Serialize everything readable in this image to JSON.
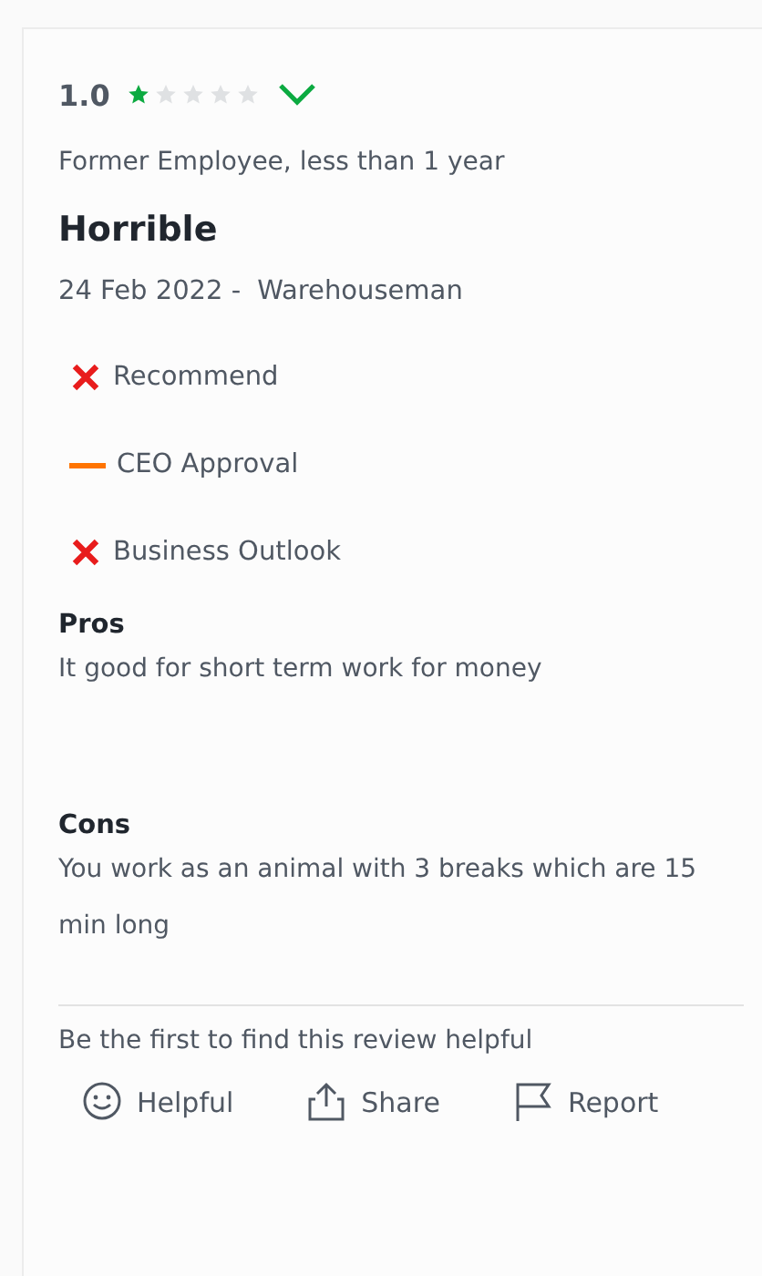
{
  "review": {
    "rating": "1.0",
    "stars": 1,
    "expanded": false,
    "employment": "Former Employee, less than 1 year",
    "title": "Horrible",
    "date": "24 Feb 2022 -",
    "job": "Warehouseman",
    "indicators": [
      {
        "kind": "no",
        "label": "Recommend"
      },
      {
        "kind": "neutral",
        "label": "CEO Approval"
      },
      {
        "kind": "no",
        "label": "Business Outlook"
      }
    ],
    "sections": [
      {
        "heading": "Pros",
        "text": "It good for short term work for money"
      },
      {
        "heading": "Cons",
        "text": "You work as an animal with 3 breaks which are 15 min long"
      }
    ],
    "helpful_note": "Be the first to find this review helpful",
    "actions": [
      {
        "kind": "helpful",
        "label": "Helpful"
      },
      {
        "kind": "share",
        "label": "Share"
      },
      {
        "kind": "report",
        "label": "Report"
      }
    ]
  }
}
